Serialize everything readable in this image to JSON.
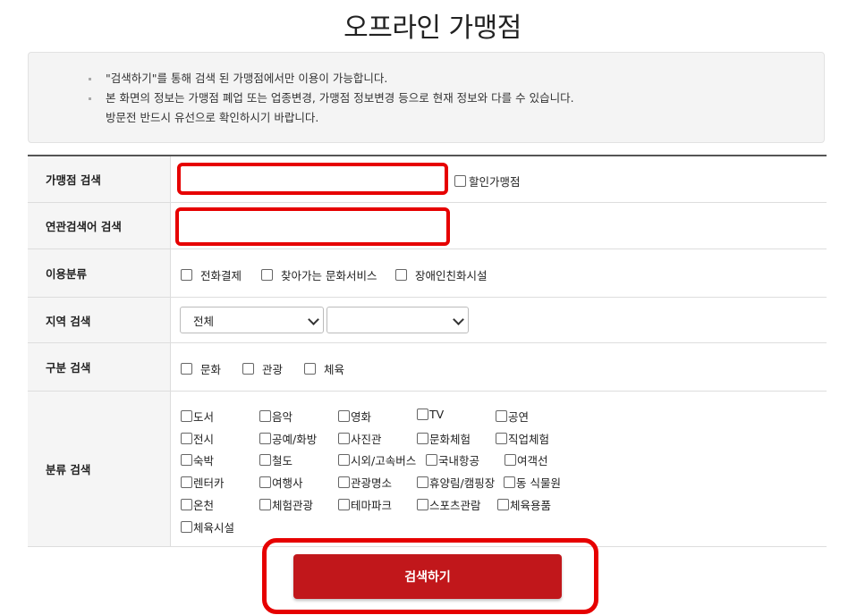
{
  "page": {
    "title": "오프라인 가맹점"
  },
  "notice": {
    "lines": [
      "\"검색하기\"를 통해 검색 된 가맹점에서만 이용이 가능합니다.",
      "본 화면의 정보는 가맹점 폐업 또는 업종변경, 가맹점 정보변경 등으로 현재 정보와 다를 수 있습니다.",
      "방문전 반드시 유선으로 확인하시기 바랍니다."
    ]
  },
  "form": {
    "store_search": {
      "label": "가맹점 검색",
      "value": "",
      "discount_label": "할인가맹점"
    },
    "keyword_search": {
      "label": "연관검색어 검색",
      "value": ""
    },
    "usage": {
      "label": "이용분류",
      "options": [
        "전화결제",
        "찾아가는 문화서비스",
        "장애인친화시설"
      ]
    },
    "region": {
      "label": "지역 검색",
      "select1": "전체",
      "select2": ""
    },
    "division": {
      "label": "구분 검색",
      "options": [
        "문화",
        "관광",
        "체육"
      ]
    },
    "category": {
      "label": "분류 검색",
      "options": [
        "도서",
        "음악",
        "영화",
        "TV",
        "공연",
        "전시",
        "공예/화방",
        "사진관",
        "문화체험",
        "직업체험",
        "숙박",
        "철도",
        "시외/고속버스",
        "국내항공",
        "여객선",
        "렌터카",
        "여행사",
        "관광명소",
        "휴양림/캠핑장",
        "동 식물원",
        "온천",
        "체험관광",
        "테마파크",
        "스포츠관람",
        "체육용품",
        "체육시설"
      ]
    }
  },
  "search_button": {
    "label": "검색하기"
  },
  "colors": {
    "highlight": "#e60000",
    "button": "#c1171b"
  }
}
